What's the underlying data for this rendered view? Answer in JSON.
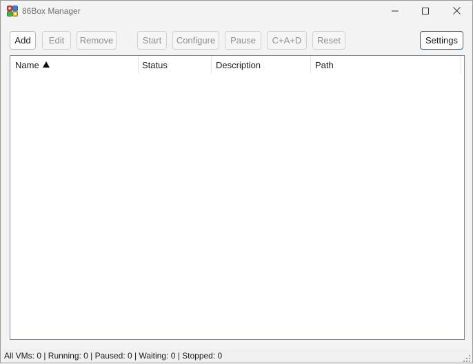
{
  "window": {
    "title": "86Box Manager"
  },
  "toolbar": {
    "add_label": "Add",
    "edit_label": "Edit",
    "remove_label": "Remove",
    "start_label": "Start",
    "configure_label": "Configure",
    "pause_label": "Pause",
    "cad_label": "C+A+D",
    "reset_label": "Reset",
    "settings_label": "Settings"
  },
  "vm_list": {
    "columns": [
      "Name",
      "Status",
      "Description",
      "Path"
    ],
    "sort_column": "Name",
    "sort_direction": "ascending",
    "rows": []
  },
  "statusbar": {
    "text": "All VMs: 0 | Running: 0 | Paused: 0 | Waiting: 0 | Stopped: 0"
  },
  "icons": {
    "app": "86box-app-icon",
    "minimize": "minimize-icon",
    "maximize": "maximize-icon",
    "close": "close-icon",
    "sort": "sort-ascending-icon",
    "grip": "resize-grip-icon"
  },
  "colors": {
    "focus_border": "#0f6cbd",
    "disabled_text": "#8f8f8f"
  }
}
